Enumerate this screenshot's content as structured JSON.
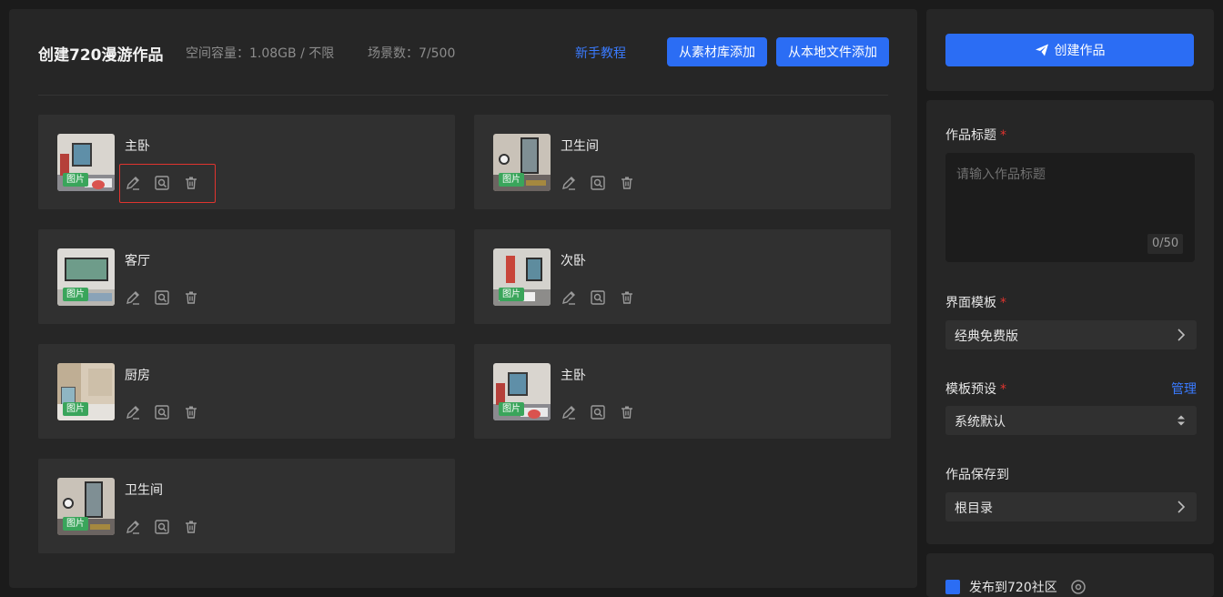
{
  "header": {
    "title": "创建720漫游作品",
    "capacity": "空间容量：1.08GB / 不限",
    "scenes": "场景数：7/500",
    "tutorial": "新手教程",
    "add_from_library": "从素材库添加",
    "add_from_local": "从本地文件添加"
  },
  "scene_badge": "图片",
  "scenes": [
    {
      "name": "主卧"
    },
    {
      "name": "卫生间"
    },
    {
      "name": "客厅"
    },
    {
      "name": "次卧"
    },
    {
      "name": "厨房"
    },
    {
      "name": "主卧"
    },
    {
      "name": "卫生间"
    }
  ],
  "sidebar": {
    "create_button": "创建作品",
    "title_label": "作品标题",
    "required_mark": "*",
    "title_placeholder": "请输入作品标题",
    "title_count": "0/50",
    "template_label": "界面模板",
    "template_value": "经典免费版",
    "preset_label": "模板预设",
    "preset_manage": "管理",
    "preset_value": "系统默认",
    "save_to_label": "作品保存到",
    "save_to_value": "根目录",
    "publish_label": "发布到720社区"
  },
  "colors": {
    "accent": "#2b6df4",
    "link": "#3a7bff",
    "required": "#e0342f",
    "badge": "#3aa55b",
    "highlight": "#e0342f"
  }
}
